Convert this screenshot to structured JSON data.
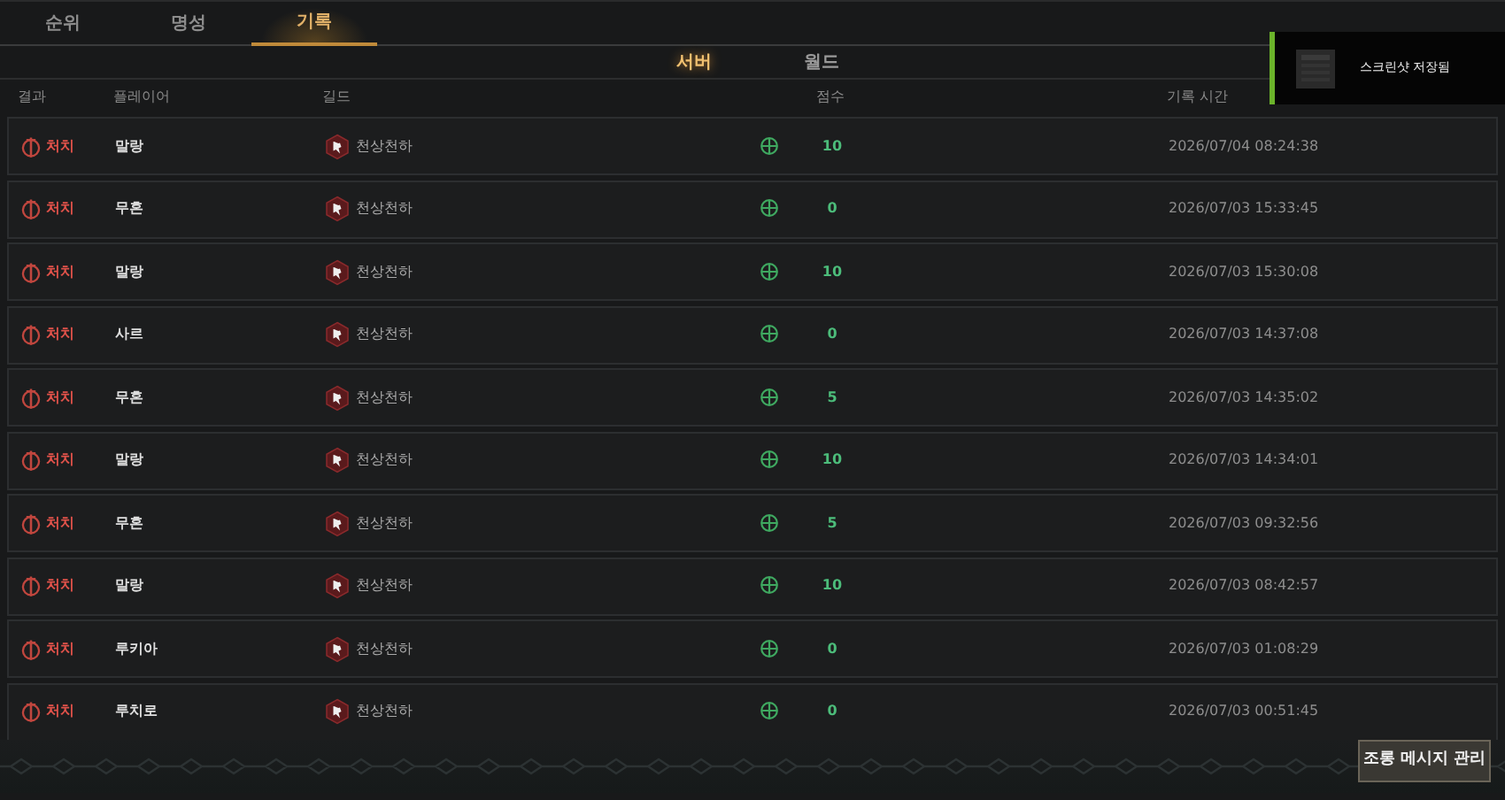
{
  "tabs": [
    {
      "label": "순위",
      "selected": false
    },
    {
      "label": "명성",
      "selected": false
    },
    {
      "label": "기록",
      "selected": true
    }
  ],
  "scope_tabs": [
    {
      "label": "서버",
      "selected": true
    },
    {
      "label": "월드",
      "selected": false
    }
  ],
  "table": {
    "columns": [
      "결과",
      "플레이어",
      "길드",
      "점수",
      "기록 시간"
    ],
    "rows": [
      {
        "result": "처치",
        "player": "말랑",
        "guild": "천상천하",
        "score": "10",
        "time": "2026/07/04 08:24:38"
      },
      {
        "result": "처치",
        "player": "무혼",
        "guild": "천상천하",
        "score": "0",
        "time": "2026/07/03 15:33:45"
      },
      {
        "result": "처치",
        "player": "말랑",
        "guild": "천상천하",
        "score": "10",
        "time": "2026/07/03 15:30:08"
      },
      {
        "result": "처치",
        "player": "사르",
        "guild": "천상천하",
        "score": "0",
        "time": "2026/07/03 14:37:08"
      },
      {
        "result": "처치",
        "player": "무혼",
        "guild": "천상천하",
        "score": "5",
        "time": "2026/07/03 14:35:02"
      },
      {
        "result": "처치",
        "player": "말랑",
        "guild": "천상천하",
        "score": "10",
        "time": "2026/07/03 14:34:01"
      },
      {
        "result": "처치",
        "player": "무혼",
        "guild": "천상천하",
        "score": "5",
        "time": "2026/07/03 09:32:56"
      },
      {
        "result": "처치",
        "player": "말랑",
        "guild": "천상천하",
        "score": "10",
        "time": "2026/07/03 08:42:57"
      },
      {
        "result": "처치",
        "player": "루키아",
        "guild": "천상천하",
        "score": "0",
        "time": "2026/07/03 01:08:29"
      },
      {
        "result": "처치",
        "player": "루치로",
        "guild": "천상천하",
        "score": "0",
        "time": "2026/07/03 00:51:45"
      }
    ]
  },
  "toast": {
    "message": "스크린샷 저장됨"
  },
  "buttons": [
    "조롱 메시지 관리"
  ]
}
